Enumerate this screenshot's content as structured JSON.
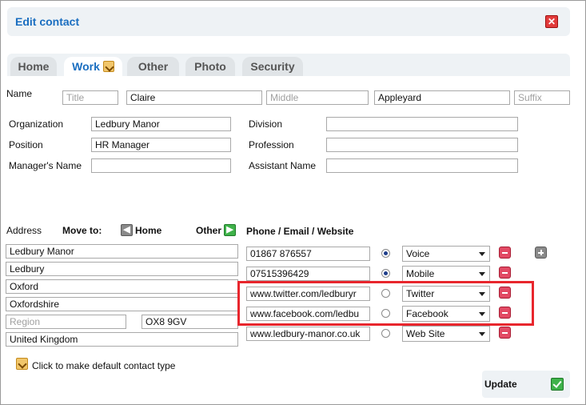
{
  "dialog": {
    "title": "Edit contact"
  },
  "tabs": [
    {
      "label": "Home",
      "active": false
    },
    {
      "label": "Work",
      "active": true
    },
    {
      "label": "Other",
      "active": false
    },
    {
      "label": "Photo",
      "active": false
    },
    {
      "label": "Security",
      "active": false
    }
  ],
  "name": {
    "label": "Name",
    "title_placeholder": "Title",
    "first": "Claire",
    "middle_placeholder": "Middle",
    "last": "Appleyard",
    "suffix_placeholder": "Suffix"
  },
  "work": {
    "organization_label": "Organization",
    "organization": "Ledbury Manor",
    "position_label": "Position",
    "position": "HR Manager",
    "managers_name_label": "Manager's Name",
    "managers_name": "",
    "division_label": "Division",
    "division": "",
    "profession_label": "Profession",
    "profession": "",
    "assistant_name_label": "Assistant Name",
    "assistant_name": ""
  },
  "address": {
    "label": "Address",
    "move_to_label": "Move to:",
    "home_button_label": "Home",
    "other_button_label": "Other",
    "line1": "Ledbury Manor",
    "line2": "Ledbury",
    "city": "Oxford",
    "county": "Oxfordshire",
    "region_placeholder": "Region",
    "postcode": "OX8 9GV",
    "country": "United Kingdom"
  },
  "contact_methods": {
    "heading": "Phone / Email / Website",
    "rows": [
      {
        "value": "01867 876557",
        "type": "Voice",
        "default": true
      },
      {
        "value": "07515396429",
        "type": "Mobile",
        "default": true
      },
      {
        "value": "www.twitter.com/ledburyr",
        "type": "Twitter",
        "default": false
      },
      {
        "value": "www.facebook.com/ledbu",
        "type": "Facebook",
        "default": false
      },
      {
        "value": "www.ledbury-manor.co.uk",
        "type": "Web Site",
        "default": false
      }
    ]
  },
  "footer": {
    "default_contact_hint": "Click to make default contact type",
    "update_label": "Update"
  },
  "colors": {
    "accent": "#1a6ec0",
    "highlight_border": "#e8262d",
    "panel_bg": "#eef2f5",
    "remove_button": "#e24a64",
    "update_check": "#3fb24a"
  },
  "icons": [
    "close-icon",
    "edit-icon",
    "arrow-left-icon",
    "arrow-right-icon",
    "remove-icon",
    "add-icon",
    "checkmark-icon",
    "dropdown-arrow-icon"
  ]
}
